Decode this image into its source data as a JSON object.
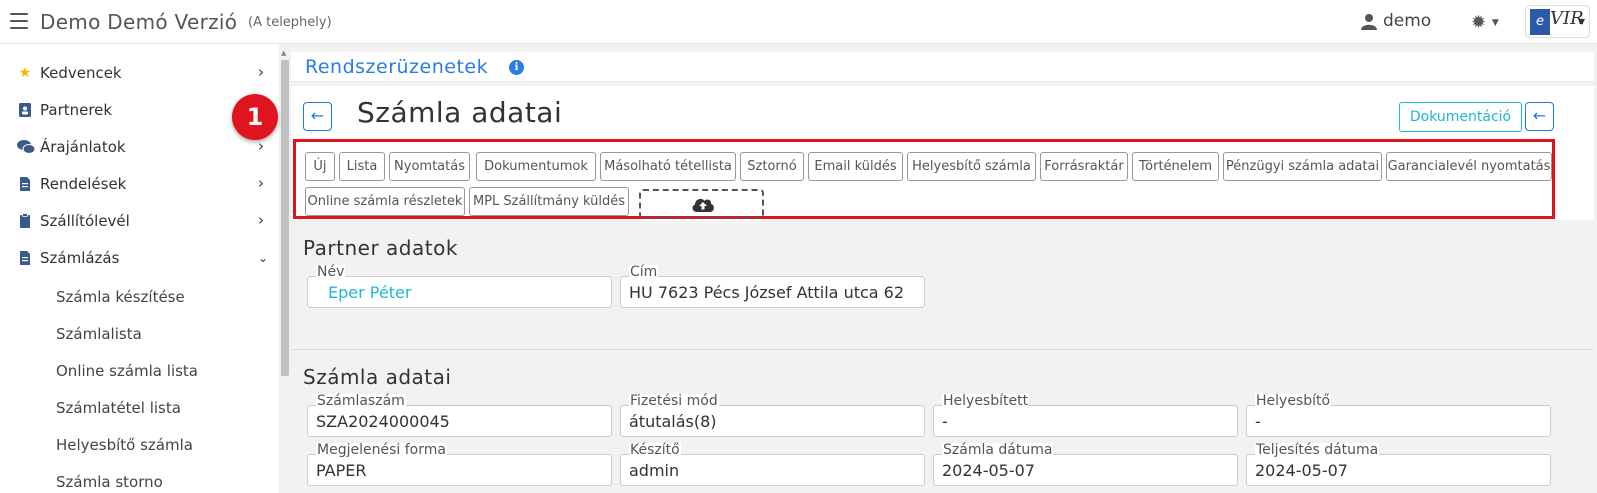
{
  "header": {
    "app_title": "Demo Demó Verzió",
    "app_subtitle": "(A telephely)",
    "user_name": "demo",
    "logo_e": "e",
    "logo_text": "VIR"
  },
  "sidebar": {
    "items": [
      {
        "label": "Kedvencek",
        "icon": "star-icon"
      },
      {
        "label": "Partnerek",
        "icon": "contact-card-icon"
      },
      {
        "label": "Árajánlatok",
        "icon": "comments-icon"
      },
      {
        "label": "Rendelések",
        "icon": "document-icon"
      },
      {
        "label": "Szállítólevél",
        "icon": "clipboard-icon"
      },
      {
        "label": "Számlázás",
        "icon": "invoice-icon"
      }
    ],
    "sub_items": [
      "Számla készítése",
      "Számlalista",
      "Online számla lista",
      "Számlatétel lista",
      "Helyesbítő számla",
      "Számla storno"
    ]
  },
  "messages": {
    "title": "Rendszerüzenetek",
    "info": "i"
  },
  "page": {
    "title": "Számla adatai",
    "doc_button": "Dokumentáció",
    "back_arrow": "←"
  },
  "toolbar": {
    "buttons": [
      "Új",
      "Lista",
      "Nyomtatás",
      "Dokumentumok",
      "Másolható tétellista",
      "Sztornó",
      "Email küldés",
      "Helyesbítő számla",
      "Forrásraktár",
      "Történelem",
      "Pénzügyi számla adatai",
      "Garancialevél nyomtatás",
      "Online számla részletek",
      "MPL Szállítmány küldés"
    ],
    "upload_icon": "cloud-upload-icon"
  },
  "annotation_badge": "1",
  "partner": {
    "section_title": "Partner adatok",
    "name_label": "Név",
    "name_value": "Eper Péter",
    "address_label": "Cím",
    "address_value": "HU 7623 Pécs József Attila utca 62"
  },
  "invoice": {
    "section_title": "Számla adatai",
    "fields": [
      {
        "label": "Számlaszám",
        "value": "SZA2024000045"
      },
      {
        "label": "Fizetési mód",
        "value": "átutalás(8)"
      },
      {
        "label": "Helyesbített",
        "value": "-"
      },
      {
        "label": "Helyesbítő",
        "value": "-"
      },
      {
        "label": "Megjelenési forma",
        "value": "PAPER"
      },
      {
        "label": "Készítő",
        "value": "admin"
      },
      {
        "label": "Számla dátuma",
        "value": "2024-05-07"
      },
      {
        "label": "Teljesítés dátuma",
        "value": "2024-05-07"
      }
    ]
  },
  "colors": {
    "accent": "#2a7de1",
    "teal": "#1fb8d4",
    "highlight": "#e0141e"
  }
}
